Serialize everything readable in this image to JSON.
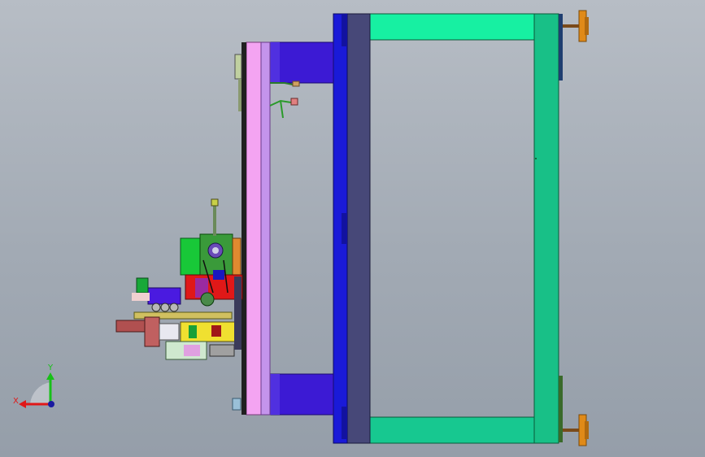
{
  "viewport": {
    "background_top": "#b7bdc5",
    "background_bottom": "#959ea9"
  },
  "model": {
    "description_colors": {
      "top_frame_rail": "#17e89a",
      "vertical_frame_post": "#17c08c",
      "mid_frame_post": "#454573",
      "blue_column": "#1a1ad8",
      "purple_blocks": "#3a1ad0",
      "pink_plate": "#f0a0f0",
      "lavender_plate": "#c090e8",
      "leveling_feet": "#d98a1a",
      "motor_green": "#34a83a",
      "brake_red": "#b04a4a"
    }
  },
  "triad": {
    "x_label": "X",
    "y_label": "Y",
    "x_color": "#e01818",
    "y_color": "#18c018",
    "origin_color": "#1a1aa0"
  }
}
